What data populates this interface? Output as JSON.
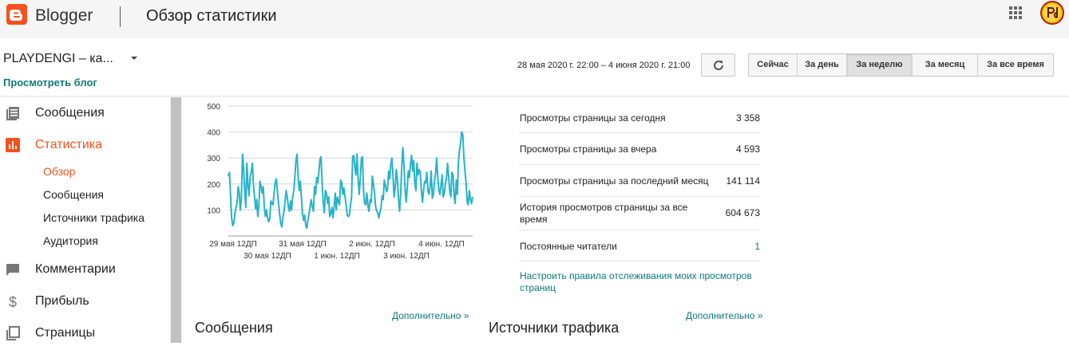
{
  "header": {
    "brand": "Blogger",
    "page_title": "Обзор статистики",
    "icons": {
      "logo": "blogger-logo-icon",
      "apps": "apps-grid-icon",
      "avatar": "user-avatar"
    },
    "colors": {
      "brand": "#f4511e",
      "link": "#0b7a7a",
      "chart_line": "#26b3c9"
    }
  },
  "subheader": {
    "blog_name": "PLAYDENGI – ка...",
    "view_blog": "Просмотреть блог",
    "date_range": "28 мая 2020 г. 22:00 – 4 июня 2020 г. 21:00",
    "ranges": [
      "Сейчас",
      "За день",
      "За неделю",
      "За месяц",
      "За все время"
    ],
    "active_range": "За неделю"
  },
  "sidebar": {
    "items": [
      {
        "label": "Сообщения",
        "icon": "posts-icon"
      },
      {
        "label": "Статистика",
        "icon": "stats-icon",
        "active": true
      },
      {
        "label": "Комментарии",
        "icon": "comments-icon"
      },
      {
        "label": "Прибыль",
        "icon": "dollar-icon"
      },
      {
        "label": "Страницы",
        "icon": "pages-icon"
      }
    ],
    "subitems": [
      "Обзор",
      "Сообщения",
      "Источники трафика",
      "Аудитория"
    ],
    "active_subitem": "Обзор"
  },
  "chart_data": {
    "type": "line",
    "y_ticks": [
      "500",
      "400",
      "300",
      "200",
      "100"
    ],
    "ylim": [
      0,
      500
    ],
    "grid": true,
    "x_labels_top": [
      "29 мая 12ДП",
      "31 мая 12ДП",
      "2 июн. 12ДП",
      "4 июн. 12ДП"
    ],
    "x_labels_bottom": [
      "30 мая 12ДП",
      "1 июн. 12ДП",
      "3 июн. 12ДП"
    ],
    "x": [
      "28.05 22:00",
      "4.06 21:00"
    ],
    "values": [
      230,
      245,
      165,
      70,
      40,
      50,
      85,
      110,
      125,
      190,
      165,
      100,
      150,
      315,
      260,
      175,
      110,
      280,
      195,
      155,
      230,
      245,
      280,
      200,
      150,
      105,
      140,
      75,
      120,
      210,
      190,
      165,
      190,
      110,
      75,
      100,
      70,
      55,
      65,
      135,
      125,
      120,
      170,
      205,
      220,
      170,
      130,
      85,
      50,
      35,
      70,
      95,
      130,
      175,
      150,
      115,
      95,
      135,
      100,
      150,
      175,
      225,
      290,
      315,
      230,
      175,
      210,
      150,
      85,
      60,
      80,
      40,
      30,
      60,
      85,
      115,
      140,
      110,
      95,
      190,
      160,
      225,
      205,
      245,
      295,
      305,
      205,
      130,
      90,
      175,
      165,
      125,
      150,
      75,
      85,
      110,
      70,
      110,
      165,
      100,
      150,
      130,
      120,
      215,
      205,
      160,
      185,
      150,
      120,
      80,
      75,
      80,
      120,
      150,
      305,
      310,
      265,
      235,
      315,
      215,
      160,
      220,
      300,
      305,
      175,
      125,
      120,
      165,
      115,
      95,
      140,
      130,
      230,
      200,
      165,
      115,
      95,
      90,
      70,
      90,
      110,
      155,
      140,
      215,
      195,
      170,
      180,
      250,
      220,
      275,
      300,
      230,
      150,
      185,
      255,
      220,
      145,
      95,
      155,
      265,
      340,
      275,
      185,
      130,
      180,
      250,
      225,
      275,
      310,
      250,
      290,
      205,
      175,
      280,
      235,
      255,
      245,
      175,
      130,
      175,
      210,
      205,
      245,
      175,
      160,
      190,
      250,
      145,
      160,
      210,
      240,
      300,
      230,
      175,
      160,
      195,
      235,
      150,
      165,
      200,
      220,
      280,
      230,
      175,
      150,
      245,
      235,
      155,
      125,
      215,
      160,
      290,
      330,
      360,
      400,
      390,
      300,
      250,
      205,
      130,
      120,
      175,
      140,
      125,
      150
    ]
  },
  "stats": {
    "rows": [
      {
        "label": "Просмотры страницы за сегодня",
        "value": "3 358"
      },
      {
        "label": "Просмотры страницы за вчера",
        "value": "4 593"
      },
      {
        "label": "Просмотры страницы за последний месяц",
        "value": "141 114"
      },
      {
        "label": "История просмотров страницы за все время",
        "value": "604 673"
      },
      {
        "label": "Постоянные читатели",
        "value": "1"
      }
    ],
    "tracking_link": "Настроить правила отслеживания моих просмотров страниц"
  },
  "sections": {
    "more_label": "Дополнительно »",
    "posts_title": "Сообщения",
    "traffic_title": "Источники трафика"
  }
}
